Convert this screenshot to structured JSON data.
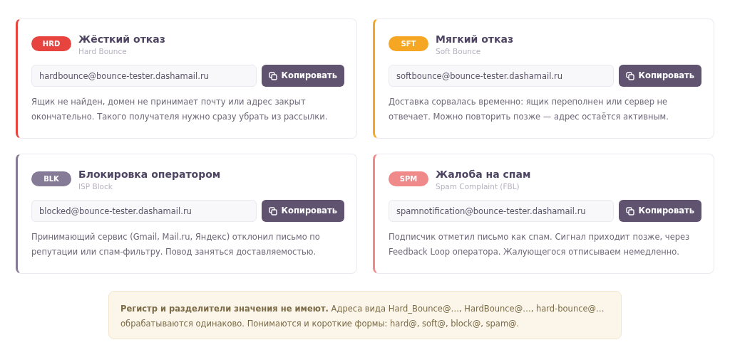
{
  "cards": [
    {
      "badge": "HRD",
      "color": "#e8443f",
      "title": "Жёсткий отказ",
      "subtitle": "Hard Bounce",
      "address": "hardbounce@bounce-tester.dashamail.ru",
      "button": "Копировать",
      "description": "Ящик не найден, домен не принимает почту или адрес закрыт окончательно. Такого получателя нужно сразу убрать из рассылки."
    },
    {
      "badge": "SFT",
      "color": "#f5a623",
      "title": "Мягкий отказ",
      "subtitle": "Soft Bounce",
      "address": "softbounce@bounce-tester.dashamail.ru",
      "button": "Копировать",
      "description": "Доставка сорвалась временно: ящик переполнен или сервер не отвечает. Можно повторить позже — адрес остаётся активным."
    },
    {
      "badge": "BLK",
      "color": "#867b97",
      "title": "Блокировка оператором",
      "subtitle": "ISP Block",
      "address": "blocked@bounce-tester.dashamail.ru",
      "button": "Копировать",
      "description": "Принимающий сервис (Gmail, Mail.ru, Яндекс) отклонил письмо по репутации или спам-фильтру. Повод заняться доставляемостью."
    },
    {
      "badge": "SPM",
      "color": "#f08a8a",
      "title": "Жалоба на спам",
      "subtitle": "Spam Complaint (FBL)",
      "address": "spamnotification@bounce-tester.dashamail.ru",
      "button": "Копировать",
      "description": "Подписчик отметил письмо как спам. Сигнал приходит позже, через Feedback Loop оператора. Жалующегося отписываем немедленно."
    }
  ],
  "note": "**Регистр и разделители значения не имеют.** Адреса вида Hard_Bounce@…, HardBounce@…, hard-bounce@… обрабатываются одинаково. Понимаются и короткие формы: hard@, soft@, block@, spam@."
}
